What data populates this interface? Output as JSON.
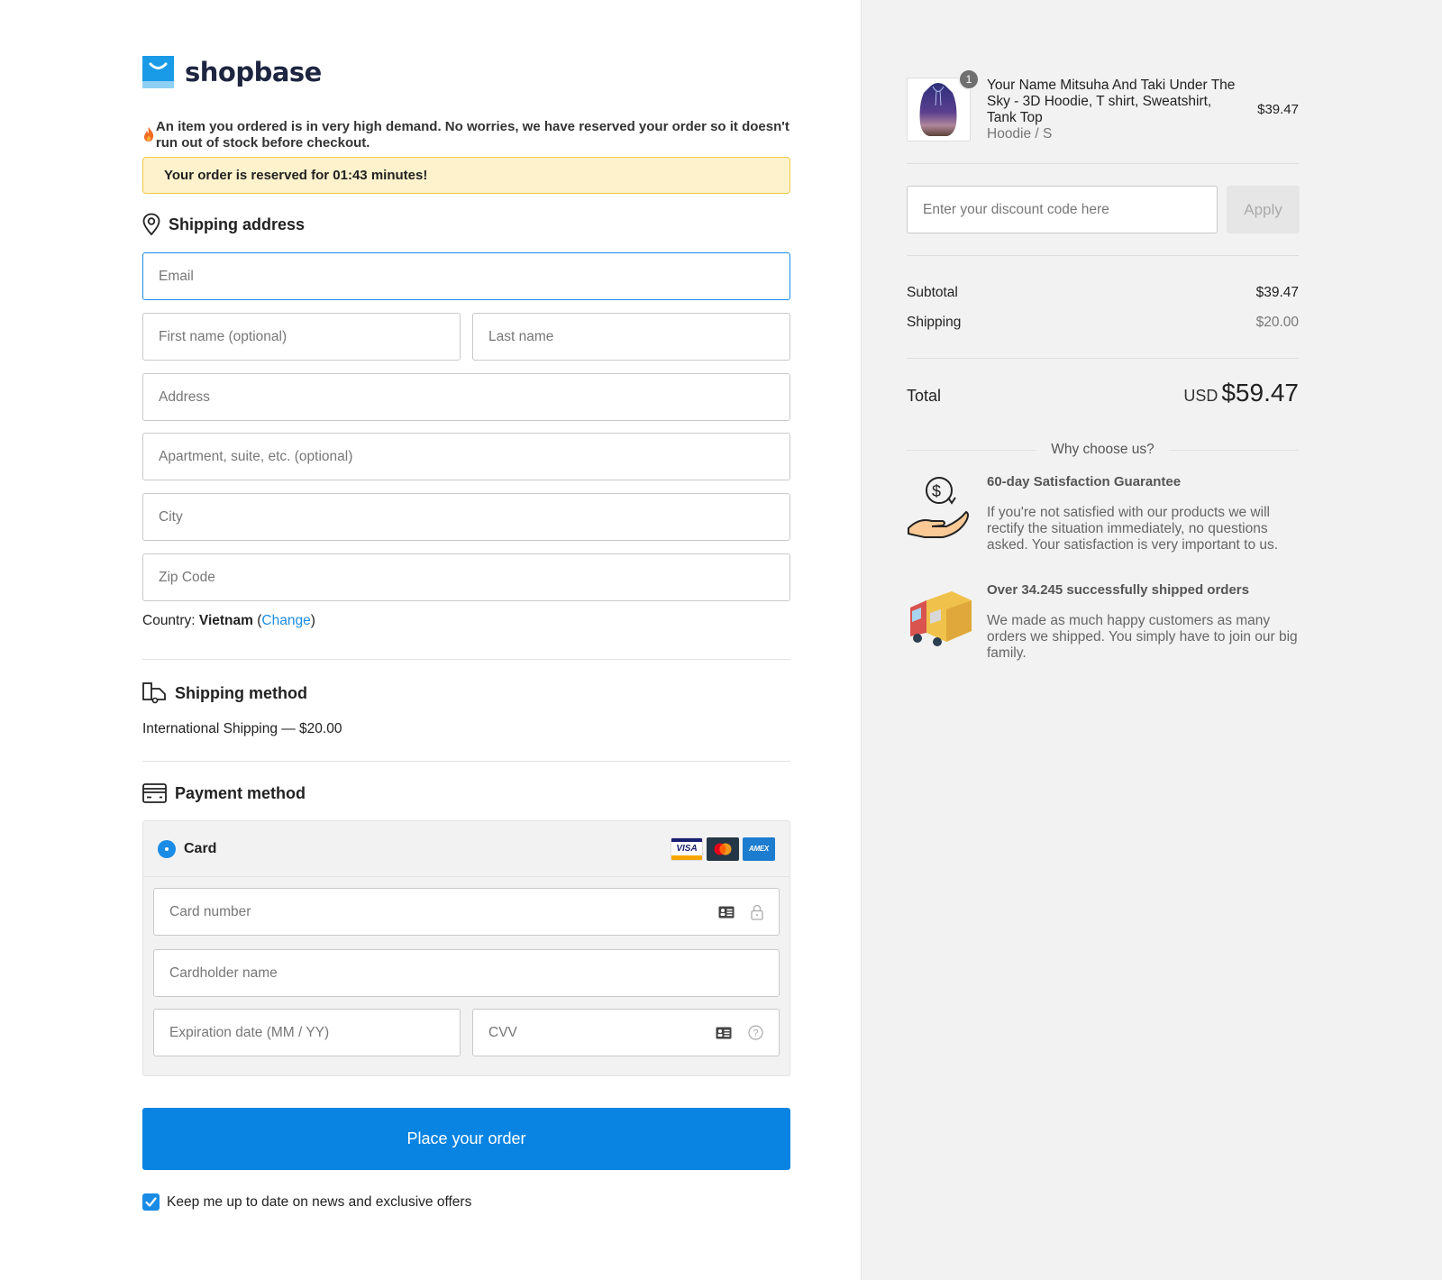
{
  "brand": {
    "name": "shopbase",
    "color": "#1a9be8"
  },
  "notice": {
    "demand_text": "An item you ordered is in very high demand. No worries, we have reserved your order so it doesn't run out of stock before checkout.",
    "reserved_text": "Your order is reserved for 01:43 minutes!",
    "timer": "01:43"
  },
  "shipping_address": {
    "title": "Shipping address",
    "fields": {
      "email": {
        "placeholder": "Email",
        "value": ""
      },
      "first_name": {
        "placeholder": "First name (optional)",
        "value": ""
      },
      "last_name": {
        "placeholder": "Last name",
        "value": ""
      },
      "address": {
        "placeholder": "Address",
        "value": ""
      },
      "apartment": {
        "placeholder": "Apartment, suite, etc. (optional)",
        "value": ""
      },
      "city": {
        "placeholder": "City",
        "value": ""
      },
      "zip": {
        "placeholder": "Zip Code",
        "value": ""
      }
    },
    "country_label": "Country:",
    "country_value": "Vietnam",
    "change_link": "Change"
  },
  "shipping_method": {
    "title": "Shipping method",
    "selected": "International Shipping — $20.00"
  },
  "payment_method": {
    "title": "Payment method",
    "option_label": "Card",
    "brands": [
      "VISA",
      "Mastercard",
      "AMEX"
    ],
    "fields": {
      "card_number": {
        "placeholder": "Card number",
        "value": ""
      },
      "cardholder": {
        "placeholder": "Cardholder name",
        "value": ""
      },
      "expiration": {
        "placeholder": "Expiration date (MM / YY)",
        "value": ""
      },
      "cvv": {
        "placeholder": "CVV",
        "value": ""
      }
    }
  },
  "place_order": {
    "label": "Place your order",
    "color": "#0a84e2"
  },
  "newsletter": {
    "label": "Keep me up to date on news and exclusive offers",
    "checked": true
  },
  "summary": {
    "item": {
      "quantity": "1",
      "name": "Your Name Mitsuha And Taki Under The Sky - 3D Hoodie, T shirt, Sweatshirt, Tank Top",
      "variant": "Hoodie / S",
      "price": "$39.47"
    },
    "discount": {
      "placeholder": "Enter your discount code here",
      "value": "",
      "apply_label": "Apply"
    },
    "subtotal_label": "Subtotal",
    "subtotal_value": "$39.47",
    "shipping_label": "Shipping",
    "shipping_value": "$20.00",
    "total_label": "Total",
    "total_currency": "USD",
    "total_value": "$59.47"
  },
  "why_choose": {
    "title": "Why choose us?",
    "features": [
      {
        "icon": "money-back-hand-icon",
        "title": "60-day Satisfaction Guarantee",
        "description": "If you're not satisfied with our products we will rectify the situation immediately, no questions asked. Your satisfaction is very important to us."
      },
      {
        "icon": "delivery-truck-icon",
        "title": "Over 34.245 successfully shipped orders",
        "description": "We made as much happy customers as many orders we shipped. You simply have to join our big family."
      }
    ]
  }
}
